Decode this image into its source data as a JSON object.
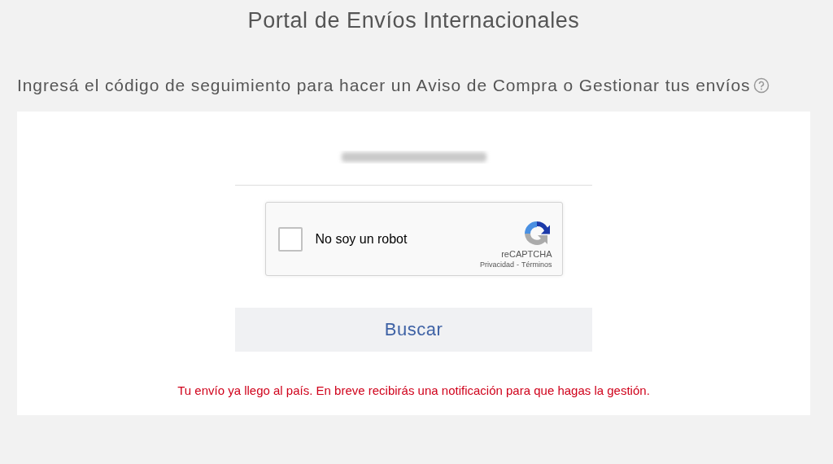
{
  "page": {
    "title": "Portal de Envíos Internacionales"
  },
  "heading": {
    "text": "Ingresá el código de seguimiento para hacer un Aviso de Compra o Gestionar tus envíos"
  },
  "captcha": {
    "label": "No soy un robot",
    "checked": false,
    "brand": "reCAPTCHA",
    "links": [
      "Privacidad",
      "Términos"
    ],
    "separator": "-"
  },
  "search_button": {
    "label": "Buscar"
  },
  "message": {
    "text": "Tu envío ya llego al país. En breve recibirás una notificación para que hagas la gestión."
  }
}
